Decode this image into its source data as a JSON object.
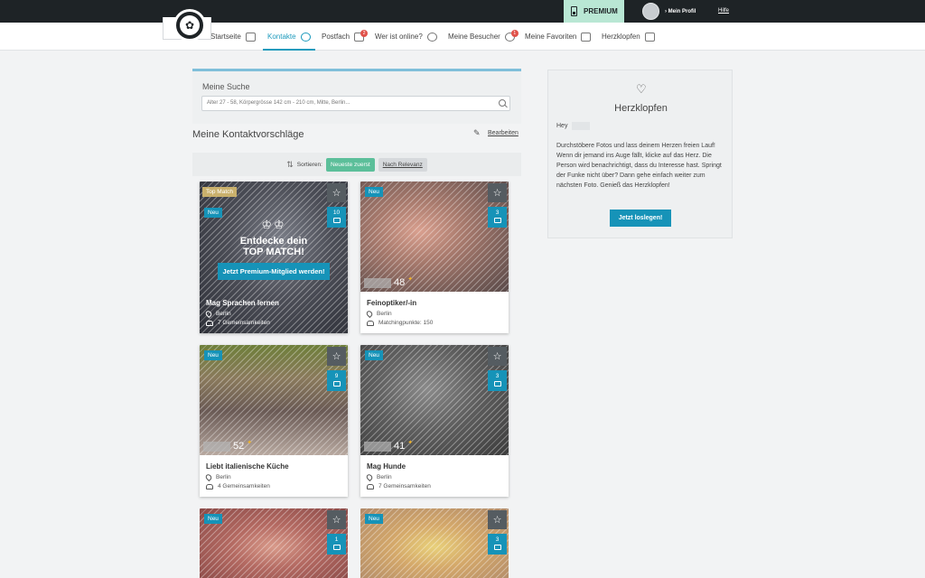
{
  "topbar": {
    "premium_label": "PREMIUM",
    "profile_label": "› Mein Profil",
    "help_label": "Hilfe"
  },
  "nav": {
    "items": [
      {
        "label": "Startseite",
        "icon": "home-icon"
      },
      {
        "label": "Kontakte",
        "icon": "person-icon",
        "active": true
      },
      {
        "label": "Postfach",
        "icon": "mail-icon",
        "badge": "2"
      },
      {
        "label": "Wer ist online?",
        "icon": "online-icon"
      },
      {
        "label": "Meine Besucher",
        "icon": "visitors-icon",
        "badge": "1"
      },
      {
        "label": "Meine Favoriten",
        "icon": "favorites-icon"
      },
      {
        "label": "Herzklopfen",
        "icon": "heart-icon"
      }
    ]
  },
  "search": {
    "title": "Meine Suche",
    "value": "Alter 27 - 58, Körpergrösse 142 cm - 210 cm, Mitte, Berlin..."
  },
  "suggestions": {
    "title": "Meine Kontaktvorschläge",
    "edit_label": "Bearbeiten",
    "sort_label": "Sortieren:",
    "sort_newest": "Neueste zuerst",
    "sort_relevance": "Nach Relevanz"
  },
  "cards": [
    {
      "name": "Mag Sprachen lernen",
      "city": "Berlin",
      "detail": "7 Gemeinsamkeiten",
      "tag_top": "Top Match",
      "tag": "Neu",
      "photos": "10",
      "promo_title1": "Entdecke dein",
      "promo_title2": "TOP MATCH!",
      "promo_button": "Jetzt Premium-Mitglied werden!"
    },
    {
      "name": "Feinoptiker/-in",
      "city": "Berlin",
      "detail": "Matchingpunkte: 150",
      "tag": "Neu",
      "photos": "3",
      "age": "48"
    },
    {
      "name": "Liebt italienische Küche",
      "city": "Berlin",
      "detail": "4 Gemeinsamkeiten",
      "tag": "Neu",
      "photos": "9",
      "age": "52"
    },
    {
      "name": "Mag Hunde",
      "city": "Berlin",
      "detail": "7 Gemeinsamkeiten",
      "tag": "Neu",
      "photos": "3",
      "age": "41"
    },
    {
      "tag": "Neu",
      "photos": "1"
    },
    {
      "tag": "Neu",
      "photos": "3"
    }
  ],
  "heart": {
    "title": "Herzklopfen",
    "greeting": "Hey",
    "text": "Durchstöbere Fotos und lass deinem Herzen freien Lauf! Wenn dir jemand ins Auge fällt, klicke auf das Herz. Die Person wird benachrichtigt, dass du Interesse hast. Springt der Funke nicht über? Dann gehe einfach weiter zum nächsten Foto. Genieß das Herzklopfen!",
    "button": "Jetzt loslegen!"
  },
  "colors": {
    "accent": "#1693b8",
    "premium": "#b9e7d4",
    "sort_active": "#5cbf9a",
    "topbar": "#1e2326"
  }
}
